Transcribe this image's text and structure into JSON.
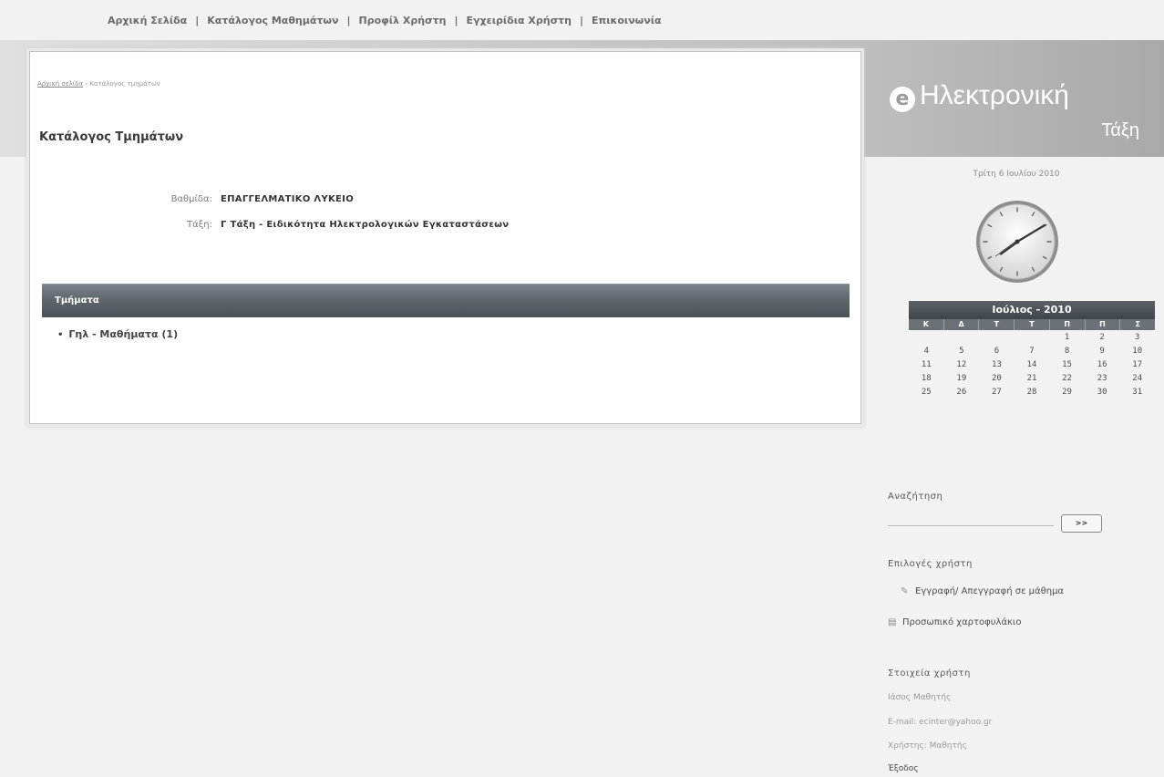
{
  "nav": [
    {
      "label": "Αρχική Σελίδα"
    },
    {
      "label": "Κατάλογος Μαθημάτων"
    },
    {
      "label": "Προφίλ Χρήστη"
    },
    {
      "label": "Εγχειρίδια Χρήστη"
    },
    {
      "label": "Επικοινωνία"
    }
  ],
  "nav_separator": "|",
  "breadcrumb": {
    "home": "Αρχική σελίδα",
    "separator": "›",
    "current": "Κατάλογος τμημάτων"
  },
  "page_title": "Κατάλογος Τμημάτων",
  "info": {
    "grade_label": "Βαθμίδα:",
    "grade_value": "ΕΠΑΓΓΕΛΜΑΤΙΚΟ ΛΥΚΕΙΟ",
    "class_label": "Τάξη:",
    "class_value": "Γ Τάξη - Ειδικότητα Ηλεκτρολογικών Εγκαταστάσεων"
  },
  "section_title": "Τμήματα",
  "sections": [
    {
      "label": "Γηλ - Μαθήματα (1)"
    }
  ],
  "logo": {
    "mark": "e",
    "line1": "Ηλεκτρονική",
    "line2": "Τάξη"
  },
  "date": "Τρίτη 6 Ιουλίου 2010",
  "calendar": {
    "title": "Ιούλιος - 2010",
    "weekdays": [
      "Κ",
      "Δ",
      "Τ",
      "Τ",
      "Π",
      "Π",
      "Σ"
    ],
    "weeks": [
      [
        "",
        "",
        "",
        "",
        "1",
        "2",
        "3"
      ],
      [
        "4",
        "5",
        "6",
        "7",
        "8",
        "9",
        "10"
      ],
      [
        "11",
        "12",
        "13",
        "14",
        "15",
        "16",
        "17"
      ],
      [
        "18",
        "19",
        "20",
        "21",
        "22",
        "23",
        "24"
      ],
      [
        "25",
        "26",
        "27",
        "28",
        "29",
        "30",
        "31"
      ]
    ]
  },
  "search": {
    "title": "Αναζήτηση",
    "value": "",
    "button": ">>"
  },
  "options": {
    "title": "Επιλογές χρήστη",
    "items": [
      {
        "label": "Εγγραφή/ Απεγγραφή σε μάθημα",
        "icon": "pencil-icon"
      },
      {
        "label": "Προσωπικό χαρτοφυλάκιο",
        "icon": "folder-icon"
      }
    ]
  },
  "user": {
    "title": "Στοιχεία χρήστη",
    "name": "Ιάσος Μαθητής",
    "email": "E-mail: ecinter@yahoo.gr",
    "role": "Χρήστης: Μαθητής",
    "logout": "Έξοδος"
  },
  "colors": {
    "section_bar": "#5f666d",
    "calendar_header": "#3f454b",
    "background": "#f2f2f2"
  }
}
